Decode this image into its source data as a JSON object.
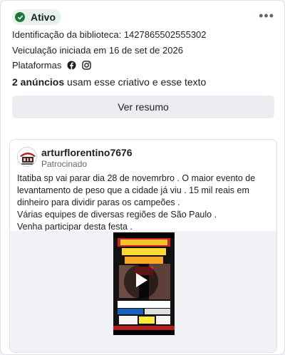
{
  "status": {
    "label": "Ativo",
    "color": "#1b7a3c",
    "icon": "check-circle-icon"
  },
  "menu": {
    "icon": "more-horizontal-icon",
    "label": "•••"
  },
  "meta": {
    "library_id": "Identificação da biblioteca: 1427865502555302",
    "started": "Veiculação iniciada em 16 de set de 2026",
    "platforms_label": "Plataformas",
    "platforms": [
      "facebook-icon",
      "instagram-icon"
    ]
  },
  "usage": {
    "count": "2 anúncios",
    "rest": " usam esse criativo e esse texto"
  },
  "summary_button": "Ver resumo",
  "post": {
    "author": "arturflorentino7676",
    "sponsored": "Patrocinado",
    "lines": [
      "Itatiba sp vai parar dia 28 de novemrbro . O maior evento de levantamento de peso que a cidade já viu . 15 mil reais em dinheiro para dividir paras os campeões .",
      "Várias equipes de diversas regiões de São Paulo .",
      "Venha participar desta festa ."
    ],
    "media": {
      "type": "video",
      "play_icon": "play-icon"
    }
  }
}
